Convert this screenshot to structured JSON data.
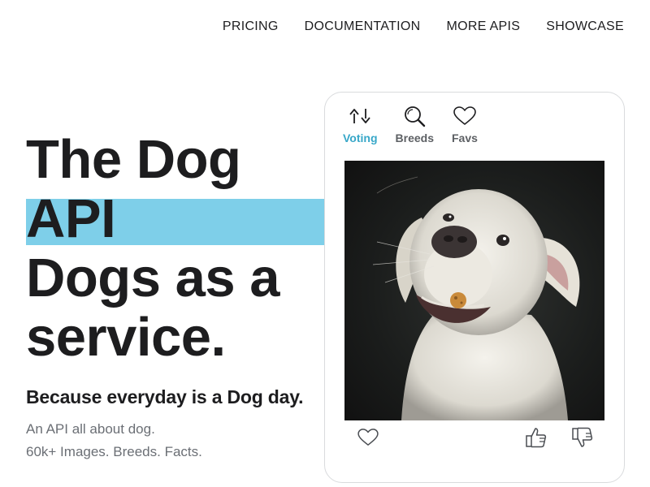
{
  "nav": {
    "items": [
      "PRICING",
      "DOCUMENTATION",
      "MORE APIS",
      "SHOWCASE"
    ]
  },
  "hero": {
    "line1": "The Dog",
    "line2": "API",
    "line3": "Dogs as a",
    "line4": "service.",
    "tagline": "Because everyday is a Dog day.",
    "desc1": "An API all about dog.",
    "desc2": "60k+ Images. Breeds. Facts."
  },
  "card": {
    "tabs": [
      {
        "label": "Voting",
        "icon": "up-down-arrows-icon"
      },
      {
        "label": "Breeds",
        "icon": "magnifier-icon"
      },
      {
        "label": "Favs",
        "icon": "heart-icon"
      }
    ],
    "active_tab": "Voting"
  },
  "colors": {
    "accent": "#37a7c8",
    "highlight": "#7ecfe9",
    "text": "#1d1d1f",
    "muted": "#6b6f75"
  }
}
